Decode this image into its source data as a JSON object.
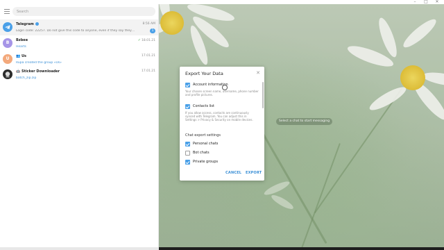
{
  "window": {
    "minimize_glyph": "–",
    "maximize_glyph": "□",
    "close_glyph": "✕"
  },
  "search": {
    "placeholder": "Search"
  },
  "chats": [
    {
      "name": "Telegram",
      "verified": true,
      "time": "8:56 AM",
      "preview": "Login code: 22257. Do not give this code to anyone, even if they say they are from Telegram! This...",
      "unread": "1",
      "avatar_letter": "",
      "avatar_color": "#4aa0e8",
      "avatar_icon": "telegram-plane-icon"
    },
    {
      "name": "Bzbee",
      "time": "18.01.21",
      "read_check": "✓",
      "preview": "Hearts",
      "avatar_letter": "B",
      "avatar_color": "#a695e7"
    },
    {
      "name": "Us",
      "time": "17.01.21",
      "preview": "Rupa created the group «Us»",
      "avatar_letter": "U",
      "avatar_color": "#f3a97c",
      "is_group": true
    },
    {
      "name": "Sticker Downloader",
      "time": "17.01.21",
      "preview": "batch_zip.zip",
      "avatar_letter": "",
      "avatar_color": "#2b2b2b",
      "is_bot": true
    }
  ],
  "main": {
    "empty_hint": "Select a chat to start messaging"
  },
  "modal": {
    "title": "Export Your Data",
    "close_glyph": "✕",
    "options": [
      {
        "label": "Account information",
        "checked": true,
        "description": "Your chosen screen name, username, phone number and profile pictures."
      },
      {
        "label": "Contacts list",
        "checked": true,
        "description": "If you allow access, contacts are continuously synced with Telegram. You can adjust this in Settings > Privacy & Security on mobile devices."
      }
    ],
    "section_header": "Chat export settings",
    "chat_options": [
      {
        "label": "Personal chats",
        "checked": true
      },
      {
        "label": "Bot chats",
        "checked": false
      },
      {
        "label": "Private groups",
        "checked": true
      }
    ],
    "cancel_label": "CANCEL",
    "export_label": "EXPORT"
  },
  "colors": {
    "accent": "#4aa0e8",
    "link": "#3a8fd6",
    "bg_green": "#b4c6ad"
  }
}
